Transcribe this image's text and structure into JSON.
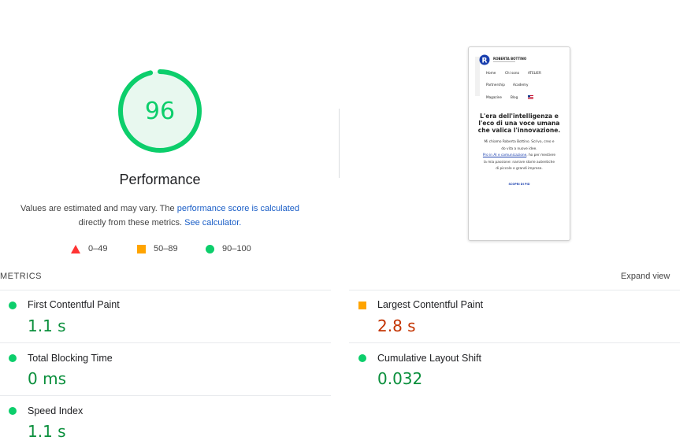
{
  "performance": {
    "score": 96,
    "title": "Performance",
    "estimate_text": "Values are estimated and may vary. The",
    "estimate_link": "performance score is calculated",
    "estimate_text2": "directly from these metrics.",
    "calculator_link": "See calculator.",
    "colors": {
      "pass": "#0cce6b",
      "average": "#ffa400",
      "fail": "#ff3333"
    }
  },
  "legend": [
    {
      "icon": "red-triangle-icon",
      "label": "0–49"
    },
    {
      "icon": "orange-square-icon",
      "label": "50–89"
    },
    {
      "icon": "green-circle-icon",
      "label": "90–100"
    }
  ],
  "screenshot": {
    "site_name": "ROBERTA BOTTINO",
    "nav": [
      "Home",
      "Chi sono",
      "ATELIER",
      "Partnership",
      "Academy",
      "Magazine",
      "Blog"
    ],
    "headline": [
      "L'era dell'intelligenza e",
      "l'eco di una voce umana",
      "che valica l'innovazione."
    ],
    "body": [
      "Mi chiamo Roberta Bottino. Scrivo, creo e",
      "do vita a nuove idee."
    ],
    "link_line": "Pro in AI e comunicazione",
    "body2_tail": ", ho per mestiere",
    "body3": [
      "la mia passione: narrare storie autentiche",
      "di piccole e grandi imprese."
    ],
    "cta": "SCOPRI DI PIÙ"
  },
  "metrics": {
    "header": "METRICS",
    "expand_label": "Expand view",
    "items": [
      {
        "name": "First Contentful Paint",
        "value": "1.1 s",
        "status": "good"
      },
      {
        "name": "Largest Contentful Paint",
        "value": "2.8 s",
        "status": "average"
      },
      {
        "name": "Total Blocking Time",
        "value": "0 ms",
        "status": "good"
      },
      {
        "name": "Cumulative Layout Shift",
        "value": "0.032",
        "status": "good"
      },
      {
        "name": "Speed Index",
        "value": "1.1 s",
        "status": "good"
      }
    ]
  }
}
